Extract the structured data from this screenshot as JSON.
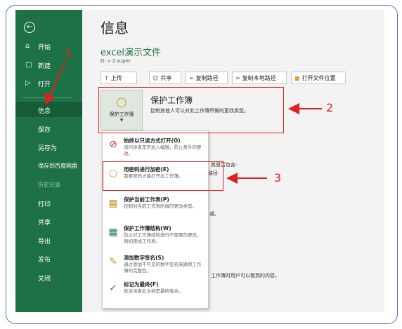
{
  "sidebar": {
    "back_icon": "back-arrow-icon",
    "items": [
      {
        "label": "开始",
        "icon": "home-icon"
      },
      {
        "label": "新建",
        "icon": "new-file-icon"
      },
      {
        "label": "打开",
        "icon": "open-folder-icon"
      },
      {
        "label": "信息",
        "icon": ""
      },
      {
        "label": "保存",
        "icon": ""
      },
      {
        "label": "另存为",
        "icon": ""
      },
      {
        "label": "保存到百度网盘",
        "icon": ""
      },
      {
        "label": "历史记录",
        "icon": ""
      },
      {
        "label": "打印",
        "icon": ""
      },
      {
        "label": "共享",
        "icon": ""
      },
      {
        "label": "导出",
        "icon": ""
      },
      {
        "label": "发布",
        "icon": ""
      },
      {
        "label": "关闭",
        "icon": ""
      }
    ]
  },
  "main": {
    "title": "信息",
    "file_name": "excel演示文件",
    "file_path": "D: » 2.super",
    "buttons": [
      {
        "label": "上传",
        "icon": "upload-icon"
      },
      {
        "label": "共享",
        "icon": "share-icon"
      },
      {
        "label": "复制路径",
        "icon": "link-icon"
      },
      {
        "label": "复制本地路径",
        "icon": "link-icon"
      },
      {
        "label": "打开文件位置",
        "icon": "folder-icon"
      }
    ],
    "protect": {
      "button_label": "保护工作簿",
      "title": "保护工作簿",
      "description": "控制其他人可以对此工作簿所做的更改类型。"
    },
    "background_fragments": [
      "其是否包含:",
      "路径",
      "或。",
      "工作簿时用户可以看到的内容。"
    ]
  },
  "dropdown": {
    "items": [
      {
        "title": "始终以只读方式打开(O)",
        "desc": "询问读者是否加入编辑，防止意外的更改。",
        "icon": "read-only-icon"
      },
      {
        "title": "用密码进行加密(E)",
        "desc": "需要密码才能打开此工作簿。",
        "icon": "encrypt-lock-icon"
      },
      {
        "title": "保护当前工作表(P)",
        "desc": "控制对当前工作表所做的更改类型。",
        "icon": "protect-sheet-icon"
      },
      {
        "title": "保护工作簿结构(W)",
        "desc": "防止对工作簿结构进行不需要的更改，例如添加工作表。",
        "icon": "workbook-structure-icon"
      },
      {
        "title": "添加数字签名(S)",
        "desc": "通过添加不可见的数字签名来确保工作簿的完整性。",
        "icon": "digital-signature-icon"
      },
      {
        "title": "标记为最终(F)",
        "desc": "告诉读者此文档是最终版本。",
        "icon": "mark-final-icon"
      }
    ]
  },
  "annotations": {
    "labels": [
      "1",
      "2",
      "3"
    ],
    "color": "#e02020"
  },
  "colors": {
    "sidebar": "#1e7145",
    "sidebar_selected": "#155d36",
    "main_bg": "#f3f3f3",
    "frame": "#5b6fcf"
  }
}
